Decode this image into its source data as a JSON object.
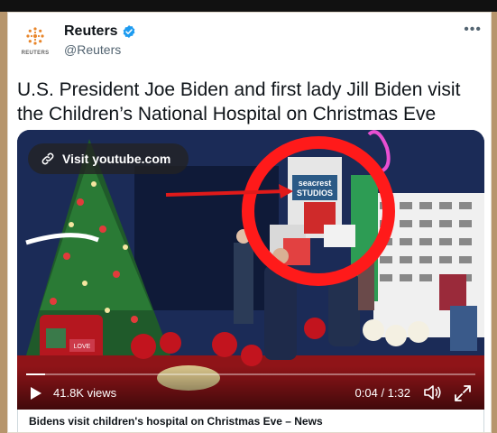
{
  "account": {
    "name": "Reuters",
    "handle": "@Reuters",
    "logo_text": "REUTERS",
    "verified": true,
    "more_label": "•••"
  },
  "tweet": {
    "text": "U.S. President Joe Biden and first lady Jill Biden visit the Children’s National Hospital on Christmas Eve"
  },
  "media": {
    "link_label": "Visit youtube.com",
    "sign_line1": "seacrest",
    "sign_line2": "STUDIOS",
    "ornament_text": "LOVE",
    "views": "41.8K views",
    "time": "0:04 / 1:32",
    "progress": 0.043
  },
  "caption": "Bidens visit children's hospital on Christmas Eve – News",
  "colors": {
    "frame": "#b6956c",
    "verified": "#1d9bf0",
    "annotation_red": "#ff1a1a",
    "annotation_pink": "#e84fd2"
  },
  "icons": [
    "reuters-logo-icon",
    "verified-badge-icon",
    "more-icon",
    "link-icon",
    "play-icon",
    "speaker-icon",
    "expand-icon"
  ]
}
